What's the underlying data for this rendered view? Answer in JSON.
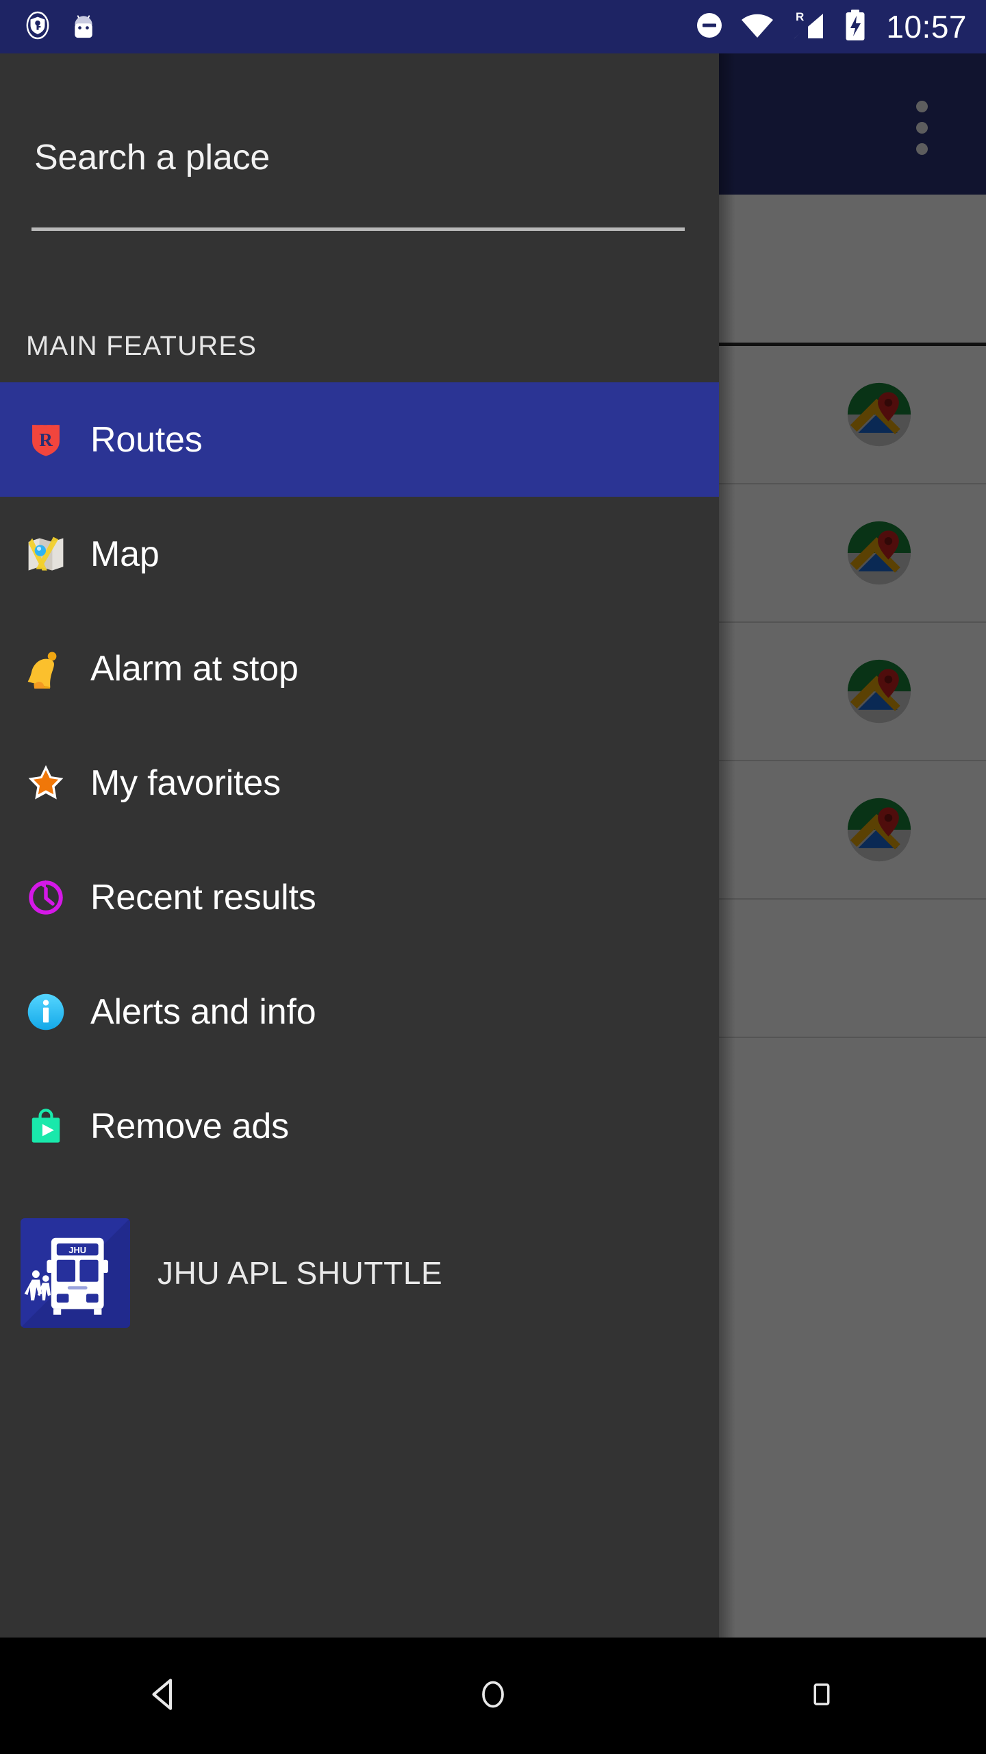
{
  "status_bar": {
    "background_color": "#1e2464",
    "time": "10:57",
    "icons": [
      {
        "name": "vpn-key-shield-icon",
        "side": "left"
      },
      {
        "name": "android-head-icon",
        "side": "left"
      },
      {
        "name": "do-not-disturb-icon",
        "side": "right"
      },
      {
        "name": "wifi-icon",
        "side": "right"
      },
      {
        "name": "roaming-signal-icon",
        "side": "right",
        "label": "R"
      },
      {
        "name": "battery-charging-icon",
        "side": "right"
      }
    ]
  },
  "drawer": {
    "background_color": "#333333",
    "search": {
      "value": "",
      "placeholder": "Search a place"
    },
    "section_header": "MAIN FEATURES",
    "selected_item": "Routes",
    "highlight_color": "#2b3494",
    "items": [
      {
        "label": "Routes",
        "icon": "route-shield-icon",
        "selected": true
      },
      {
        "label": "Map",
        "icon": "folded-map-icon",
        "selected": false
      },
      {
        "label": "Alarm at stop",
        "icon": "bell-icon",
        "selected": false
      },
      {
        "label": "My favorites",
        "icon": "star-icon",
        "selected": false
      },
      {
        "label": "Recent results",
        "icon": "history-clock-icon",
        "selected": false
      },
      {
        "label": "Alerts and info",
        "icon": "info-circle-icon",
        "selected": false
      },
      {
        "label": "Remove ads",
        "icon": "play-store-bag-icon",
        "selected": false
      }
    ],
    "promo": {
      "label": "JHU APL SHUTTLE",
      "icon": "jhu-shuttle-app-icon",
      "icon_text": "JHU"
    }
  },
  "background_app": {
    "app_bar_color": "#2b3275",
    "overflow_menu_icon": "overflow-menu-icon",
    "keyboard_icon": "keyboard-icon",
    "rows": [
      {
        "icon": "google-maps-icon"
      },
      {
        "icon": "google-maps-icon"
      },
      {
        "icon": "google-maps-icon"
      },
      {
        "icon": "google-maps-icon"
      },
      {
        "icon": ""
      }
    ]
  },
  "nav_bar": {
    "background_color": "#000000",
    "buttons": [
      {
        "name": "back-button",
        "icon": "back-triangle-icon"
      },
      {
        "name": "home-button",
        "icon": "home-circle-icon"
      },
      {
        "name": "recents-button",
        "icon": "recents-square-icon"
      }
    ]
  }
}
